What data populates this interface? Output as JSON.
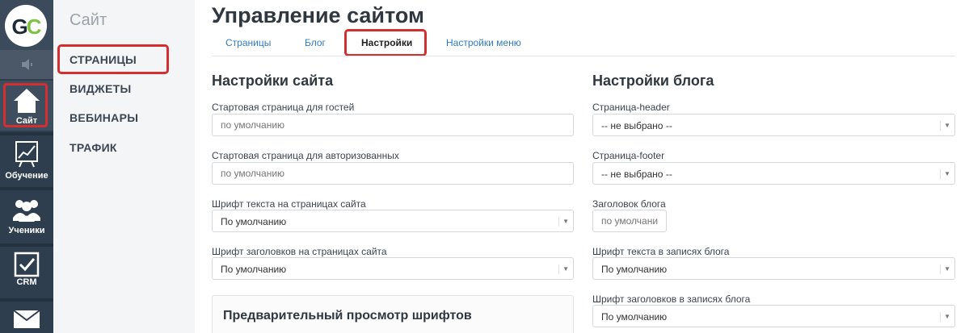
{
  "rail": {
    "logo": {
      "g": "G",
      "c": "C"
    },
    "items": [
      {
        "label": "Сайт",
        "icon": "home-icon"
      },
      {
        "label": "Обучение",
        "icon": "chart-icon"
      },
      {
        "label": "Ученики",
        "icon": "users-icon"
      },
      {
        "label": "CRM",
        "icon": "checkbox-icon"
      },
      {
        "label": "",
        "icon": "mail-icon"
      }
    ]
  },
  "subnav": {
    "title": "Сайт",
    "items": [
      "СТРАНИЦЫ",
      "ВИДЖЕТЫ",
      "ВЕБИНАРЫ",
      "ТРАФИК"
    ]
  },
  "page": {
    "title": "Управление сайтом",
    "tabs": [
      "Страницы",
      "Блог",
      "Настройки",
      "Настройки меню"
    ]
  },
  "site_settings": {
    "title": "Настройки сайта",
    "start_guest_label": "Стартовая страница для гостей",
    "start_guest_placeholder": "по умолчанию",
    "start_auth_label": "Стартовая страница для авторизованных",
    "start_auth_placeholder": "по умолчанию",
    "text_font_label": "Шрифт текста на страницах сайта",
    "text_font_value": "По умолчанию",
    "heading_font_label": "Шрифт заголовков на страницах сайта",
    "heading_font_value": "По умолчанию",
    "preview_title": "Предварительный просмотр шрифтов"
  },
  "blog_settings": {
    "title": "Настройки блога",
    "header_label": "Страница-header",
    "header_value": "-- не выбрано --",
    "footer_label": "Страница-footer",
    "footer_value": "-- не выбрано --",
    "blog_title_label": "Заголовок блога",
    "blog_title_placeholder": "по умолчанию",
    "post_text_font_label": "Шрифт текста в записях блога",
    "post_text_font_value": "По умолчанию",
    "post_heading_font_label": "Шрифт заголовков в записях блога",
    "post_heading_font_value": "По умолчанию"
  },
  "colors": {
    "rail": "#2f3e4e",
    "accent_link": "#2e7dc4",
    "highlight": "#d32f2f",
    "logo_green": "#7dc242"
  }
}
